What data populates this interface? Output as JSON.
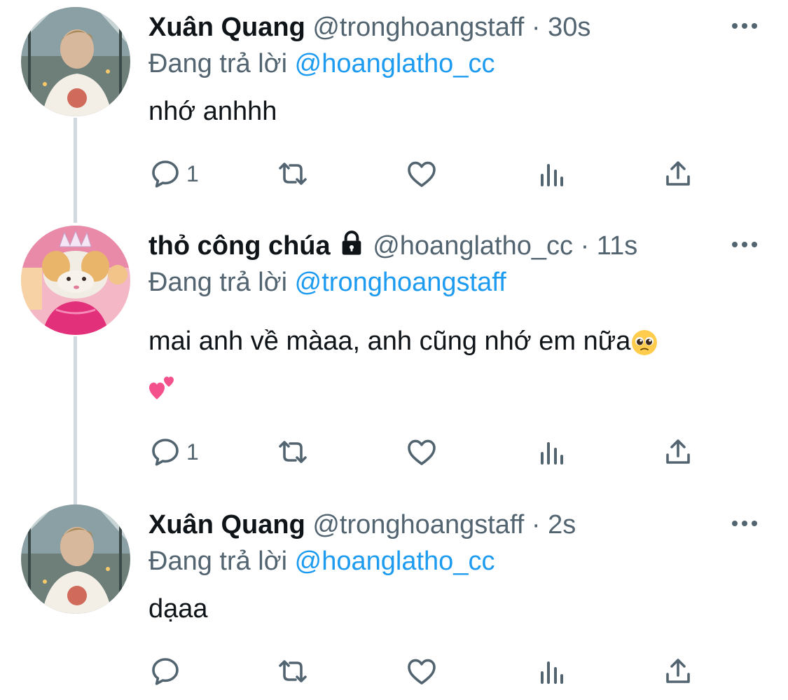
{
  "tweets": [
    {
      "author_name": "Xuân Quang",
      "author_handle": "@tronghoangstaff",
      "separator": "·",
      "time": "30s",
      "reply_prefix": "Đang trả lời",
      "reply_to": "@hoanglatho_cc",
      "text": "nhớ anhhh",
      "reply_count": "1",
      "locked": false,
      "avatar": "photo-young-man-bridge"
    },
    {
      "author_name": "thỏ công chúa",
      "author_handle": "@hoanglatho_cc",
      "separator": "·",
      "time": "11s",
      "reply_prefix": "Đang trả lời",
      "reply_to": "@tronghoangstaff",
      "text": "mai anh về màaa, anh cũng nhớ em nữa",
      "emojis": [
        "pleading-face",
        "two-hearts"
      ],
      "reply_count": "1",
      "locked": true,
      "avatar": "cartoon-bunny-princess"
    },
    {
      "author_name": "Xuân Quang",
      "author_handle": "@tronghoangstaff",
      "separator": "·",
      "time": "2s",
      "reply_prefix": "Đang trả lời",
      "reply_to": "@hoanglatho_cc",
      "text": "dạaa",
      "reply_count": "",
      "locked": false,
      "avatar": "photo-young-man-bridge"
    }
  ],
  "icons": {
    "reply": "reply-icon",
    "retweet": "retweet-icon",
    "like": "like-icon",
    "analytics": "analytics-icon",
    "share": "share-icon",
    "more": "more-icon",
    "lock": "lock-icon"
  },
  "colors": {
    "text": "#0f1419",
    "secondary": "#536471",
    "link": "#1d9bf0",
    "thread_line": "#cfd9de"
  }
}
